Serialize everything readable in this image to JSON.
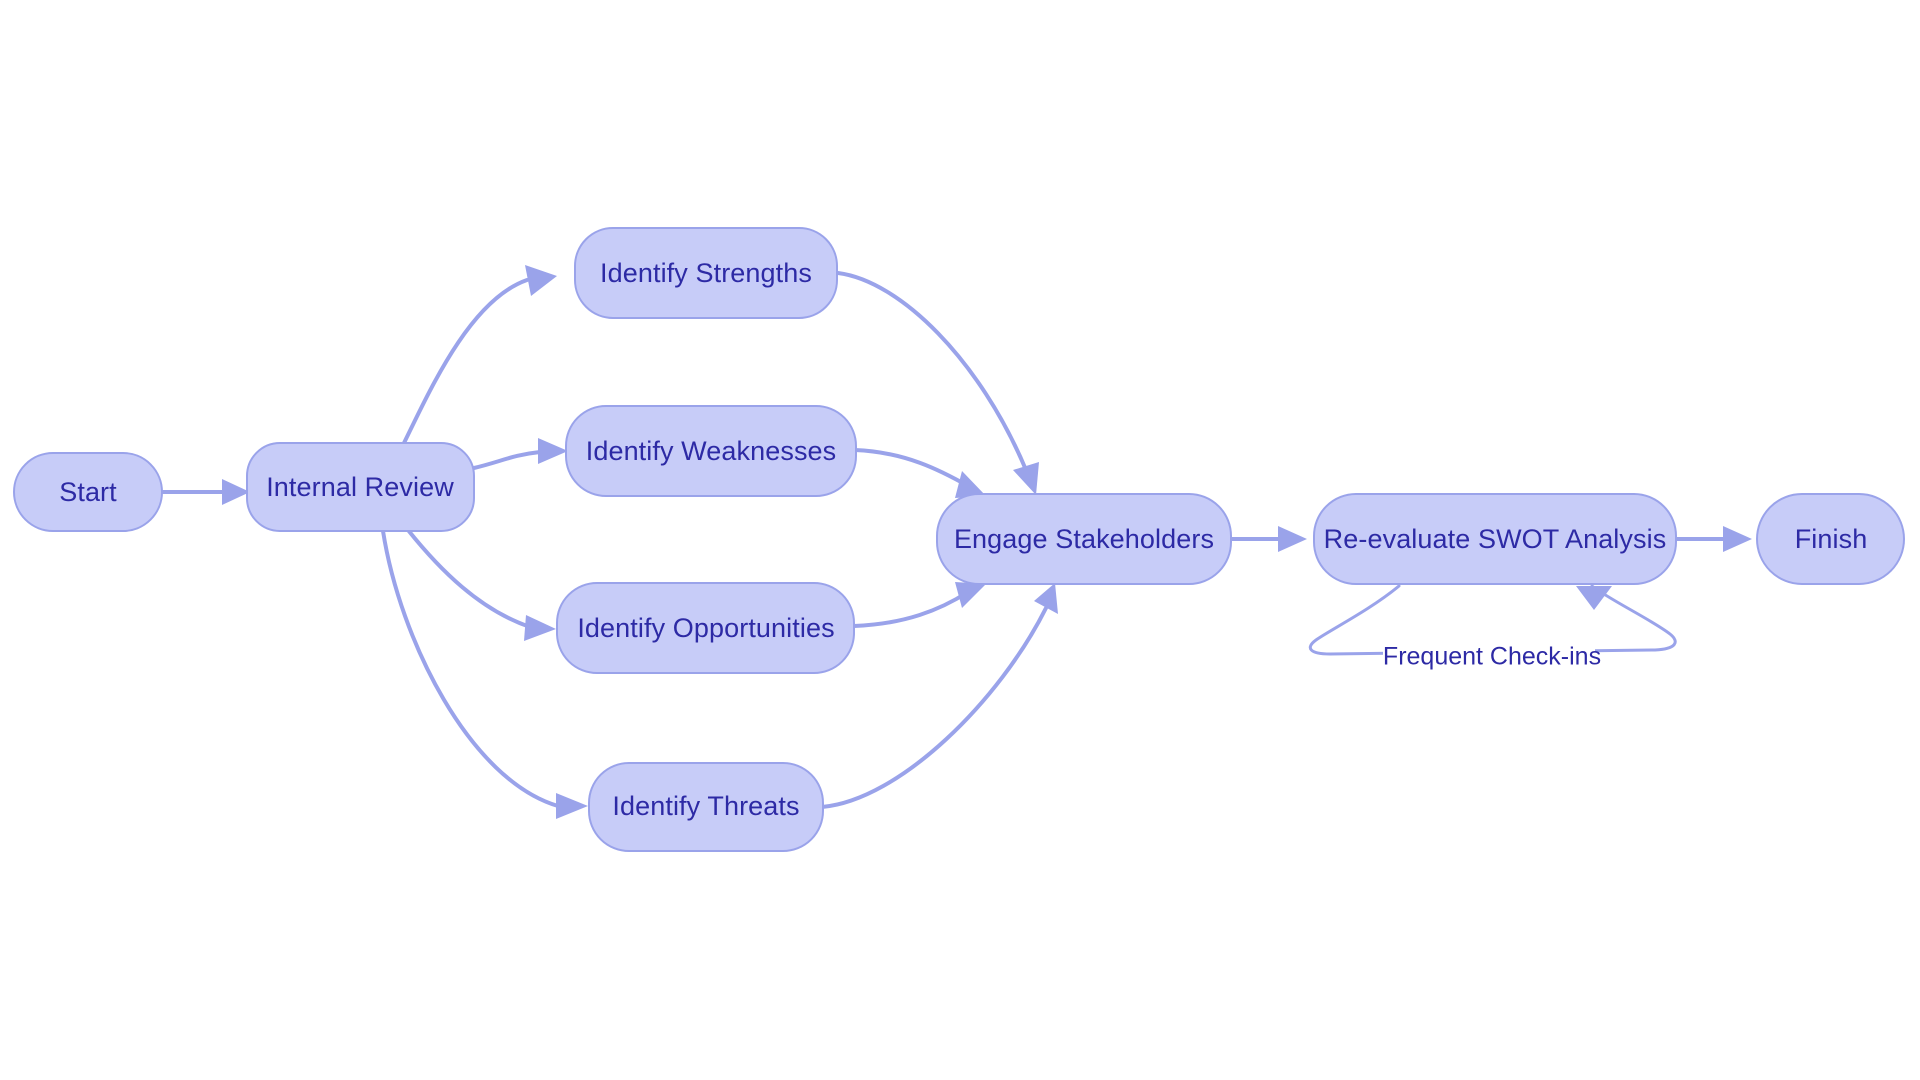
{
  "diagram": {
    "type": "flowchart",
    "orientation": "left-to-right",
    "background_color": "#ffffff",
    "node_fill_color": "#c7ccf8",
    "node_stroke_color": "#9aa3ea",
    "node_text_color": "#2d2aa5",
    "edge_color": "#9aa3ea",
    "nodes": [
      {
        "id": "start",
        "label": "Start"
      },
      {
        "id": "internal_review",
        "label": "Internal Review"
      },
      {
        "id": "identify_strengths",
        "label": "Identify Strengths"
      },
      {
        "id": "identify_weaknesses",
        "label": "Identify Weaknesses"
      },
      {
        "id": "identify_opportunities",
        "label": "Identify Opportunities"
      },
      {
        "id": "identify_threats",
        "label": "Identify Threats"
      },
      {
        "id": "engage_stakeholders",
        "label": "Engage Stakeholders"
      },
      {
        "id": "reevaluate_swot",
        "label": "Re-evaluate SWOT Analysis"
      },
      {
        "id": "finish",
        "label": "Finish"
      }
    ],
    "edges": [
      {
        "from": "start",
        "to": "internal_review",
        "label": ""
      },
      {
        "from": "internal_review",
        "to": "identify_strengths",
        "label": ""
      },
      {
        "from": "internal_review",
        "to": "identify_weaknesses",
        "label": ""
      },
      {
        "from": "internal_review",
        "to": "identify_opportunities",
        "label": ""
      },
      {
        "from": "internal_review",
        "to": "identify_threats",
        "label": ""
      },
      {
        "from": "identify_strengths",
        "to": "engage_stakeholders",
        "label": ""
      },
      {
        "from": "identify_weaknesses",
        "to": "engage_stakeholders",
        "label": ""
      },
      {
        "from": "identify_opportunities",
        "to": "engage_stakeholders",
        "label": ""
      },
      {
        "from": "identify_threats",
        "to": "engage_stakeholders",
        "label": ""
      },
      {
        "from": "engage_stakeholders",
        "to": "reevaluate_swot",
        "label": ""
      },
      {
        "from": "reevaluate_swot",
        "to": "reevaluate_swot",
        "label": "Frequent Check-ins"
      },
      {
        "from": "reevaluate_swot",
        "to": "finish",
        "label": ""
      }
    ],
    "edge_labels": {
      "feedback_loop": "Frequent Check-ins"
    }
  }
}
